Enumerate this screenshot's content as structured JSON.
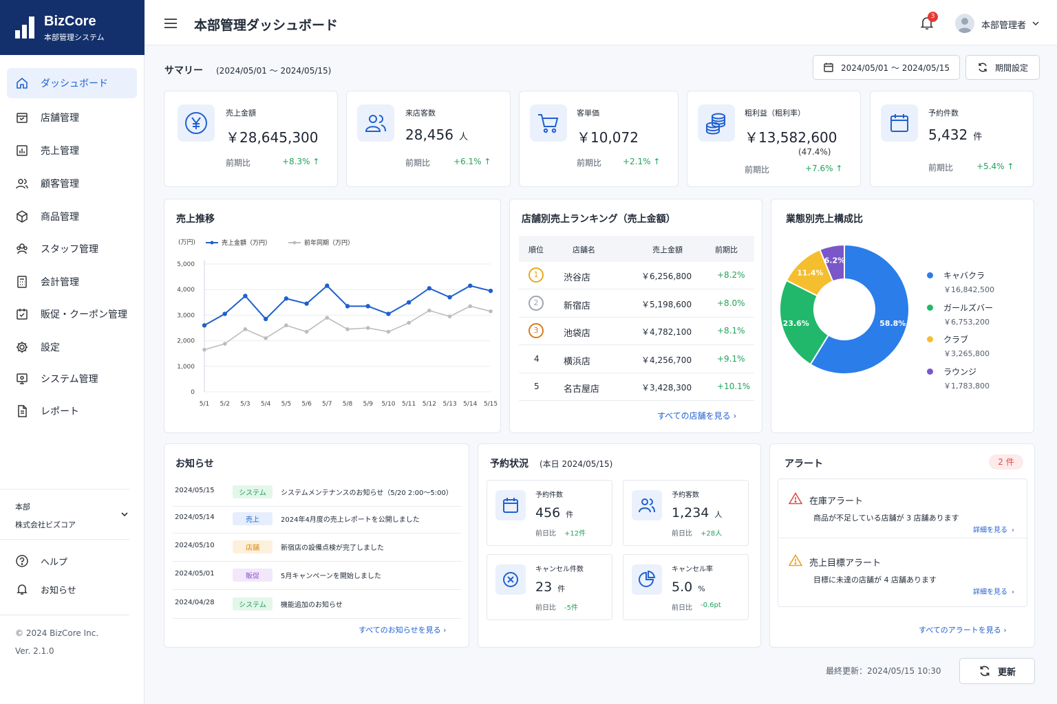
{
  "brand": {
    "name": "BizCore",
    "subtitle": "本部管理システム"
  },
  "sidebar": {
    "items": [
      {
        "label": "ダッシュボード",
        "icon": "home-icon"
      },
      {
        "label": "店舗管理",
        "icon": "store-icon"
      },
      {
        "label": "売上管理",
        "icon": "bar-chart-icon"
      },
      {
        "label": "顧客管理",
        "icon": "users-icon"
      },
      {
        "label": "商品管理",
        "icon": "box-icon"
      },
      {
        "label": "スタッフ管理",
        "icon": "staff-icon"
      },
      {
        "label": "会計管理",
        "icon": "calculator-icon"
      },
      {
        "label": "販促・クーポン管理",
        "icon": "coupon-icon"
      },
      {
        "label": "設定",
        "icon": "gear-icon"
      },
      {
        "label": "システム管理",
        "icon": "system-icon"
      },
      {
        "label": "レポート",
        "icon": "document-icon"
      }
    ],
    "org_label": "本部",
    "org_company": "株式会社ビズコア",
    "help_label": "ヘルプ",
    "notice_label": "お知らせ",
    "copyright": "© 2024 BizCore Inc.",
    "version": "Ver. 2.1.0"
  },
  "header": {
    "title": "本部管理ダッシュボード",
    "notification_count": "3",
    "user_name": "本部管理者"
  },
  "summary": {
    "title": "サマリー",
    "period": "(2024/05/01 〜 2024/05/15)",
    "date_range": "2024/05/01 〜 2024/05/15",
    "period_button": "期間設定",
    "prev_label": "前期比"
  },
  "kpis": [
    {
      "label": "売上金額",
      "value": "￥28,645,300",
      "unit": "",
      "note": "",
      "change": "+8.3%",
      "icon": "yen-icon"
    },
    {
      "label": "来店客数",
      "value": "28,456",
      "unit": "人",
      "note": "",
      "change": "+6.1%",
      "icon": "users-icon"
    },
    {
      "label": "客単価",
      "value": "￥10,072",
      "unit": "",
      "note": "",
      "change": "+2.1%",
      "icon": "cart-icon"
    },
    {
      "label": "粗利益（粗利率）",
      "value": "￥13,582,600",
      "unit": "",
      "note": "(47.4%)",
      "change": "+7.6%",
      "icon": "coins-icon"
    },
    {
      "label": "予約件数",
      "value": "5,432",
      "unit": "件",
      "note": "",
      "change": "+5.4%",
      "icon": "calendar-icon"
    }
  ],
  "chart_data": [
    {
      "type": "line",
      "title": "売上推移",
      "ylabel": "(万円)",
      "x": [
        "5/1",
        "5/2",
        "5/3",
        "5/4",
        "5/5",
        "5/6",
        "5/7",
        "5/8",
        "5/9",
        "5/10",
        "5/11",
        "5/12",
        "5/13",
        "5/14",
        "5/15"
      ],
      "yticks": [
        "5,000",
        "4,000",
        "3,000",
        "2,000",
        "1,000",
        "0"
      ],
      "ylim": [
        0,
        5000
      ],
      "legend_position": "top-left",
      "grid": true,
      "series": [
        {
          "name": "売上金額（万円）",
          "color": "#1f5fd0",
          "values": [
            2600,
            3050,
            3750,
            2850,
            3650,
            3450,
            4150,
            3350,
            3350,
            3050,
            3500,
            4050,
            3700,
            4150,
            3950
          ]
        },
        {
          "name": "前年同期（万円）",
          "color": "#bcbcbc",
          "values": [
            1650,
            1880,
            2450,
            2100,
            2600,
            2350,
            2900,
            2450,
            2500,
            2350,
            2700,
            3180,
            2950,
            3350,
            3150
          ]
        }
      ]
    },
    {
      "type": "pie",
      "title": "業態別売上構成比",
      "labels": [
        "キャバクラ",
        "ガールズバー",
        "クラブ",
        "ラウンジ"
      ],
      "values": [
        58.8,
        23.6,
        11.4,
        6.2
      ],
      "display": [
        "58.8%",
        "23.6%",
        "11.4%",
        "6.2%"
      ],
      "amounts": [
        "￥16,842,500",
        "￥6,753,200",
        "￥3,265,800",
        "￥1,783,800"
      ],
      "colors": [
        "#2b7de9",
        "#22b86b",
        "#f5be2e",
        "#7b56c8"
      ],
      "legend_position": "right"
    }
  ],
  "ranking": {
    "title": "店舗別売上ランキング（売上金額）",
    "headers": [
      "順位",
      "店舗名",
      "売上金額",
      "前期比"
    ],
    "rows": [
      {
        "rank": "1",
        "name": "渋谷店",
        "amount": "￥6,256,800",
        "change": "+8.2%"
      },
      {
        "rank": "2",
        "name": "新宿店",
        "amount": "￥5,198,600",
        "change": "+8.0%"
      },
      {
        "rank": "3",
        "name": "池袋店",
        "amount": "￥4,782,100",
        "change": "+8.1%"
      },
      {
        "rank": "4",
        "name": "横浜店",
        "amount": "￥4,256,700",
        "change": "+9.1%"
      },
      {
        "rank": "5",
        "name": "名古屋店",
        "amount": "￥3,428,300",
        "change": "+10.1%"
      }
    ],
    "link": "すべての店舗を見る"
  },
  "news": {
    "title": "お知らせ",
    "items": [
      {
        "date": "2024/05/15",
        "tag": "システム",
        "tag_color": "green",
        "text": "システムメンテナンスのお知らせ（5/20 2:00〜5:00）"
      },
      {
        "date": "2024/05/14",
        "tag": "売上",
        "tag_color": "blue",
        "text": "2024年4月度の売上レポートを公開しました"
      },
      {
        "date": "2024/05/10",
        "tag": "店舗",
        "tag_color": "orange",
        "text": "新宿店の設備点検が完了しました"
      },
      {
        "date": "2024/05/01",
        "tag": "販促",
        "tag_color": "purple",
        "text": "5月キャンペーンを開始しました"
      },
      {
        "date": "2024/04/28",
        "tag": "システム",
        "tag_color": "green",
        "text": "機能追加のお知らせ"
      }
    ],
    "link": "すべてのお知らせを見る"
  },
  "reservations": {
    "title": "予約状況",
    "date": "(本日 2024/05/15)",
    "cards": [
      {
        "label": "予約件数",
        "value": "456",
        "unit": "件",
        "delta_label": "前日比",
        "delta": "+12件",
        "icon": "calendar-icon"
      },
      {
        "label": "予約客数",
        "value": "1,234",
        "unit": "人",
        "delta_label": "前日比",
        "delta": "+28人",
        "icon": "users-icon"
      },
      {
        "label": "キャンセル件数",
        "value": "23",
        "unit": "件",
        "delta_label": "前日比",
        "delta": "-5件",
        "icon": "cancel-icon"
      },
      {
        "label": "キャンセル率",
        "value": "5.0",
        "unit": "%",
        "delta_label": "前日比",
        "delta": "-0.6pt",
        "icon": "pie-icon"
      }
    ]
  },
  "alerts": {
    "title": "アラート",
    "count": "2 件",
    "items": [
      {
        "title": "在庫アラート",
        "text": "商品が不足している店舗が 3 店舗あります",
        "link": "詳細を見る",
        "color": "#e04a4a"
      },
      {
        "title": "売上目標アラート",
        "text": "目標に未達の店舗が 4 店舗あります",
        "link": "詳細を見る",
        "color": "#f0a020"
      }
    ],
    "link": "すべてのアラートを見る"
  },
  "footer": {
    "last_updated": "最終更新：2024/05/15 10:30",
    "refresh": "更新"
  }
}
